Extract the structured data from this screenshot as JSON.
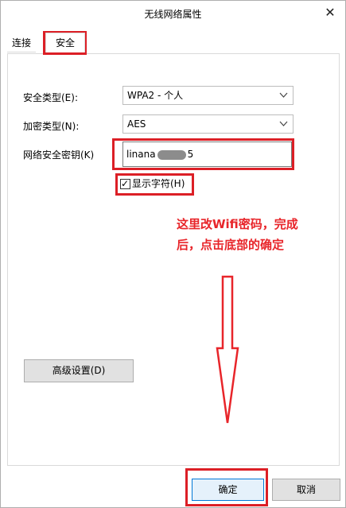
{
  "window": {
    "title": "无线网络属性",
    "close_symbol": "✕"
  },
  "tabs": [
    {
      "label": "连接",
      "selected": false
    },
    {
      "label": "安全",
      "selected": true
    }
  ],
  "form": {
    "security_type_label": "安全类型(E):",
    "security_type_value": "WPA2 - 个人",
    "encryption_type_label": "加密类型(N):",
    "encryption_type_value": "AES",
    "network_key_label": "网络安全密钥(K)",
    "network_key_prefix": "linana",
    "network_key_suffix": "5",
    "show_characters_label": "显示字符(H)",
    "show_characters_checked": true
  },
  "annotation": {
    "line1": "这里改Wifi密码，完成",
    "line2": "后，点击底部的确定"
  },
  "buttons": {
    "advanced": "高级设置(D)",
    "ok": "确定",
    "cancel": "取消"
  },
  "colors": {
    "annotation": "#e8252a",
    "highlight": "#dc1f26",
    "button_face": "#e1e1e1",
    "default_button_border": "#0078d7"
  },
  "icons": {
    "dropdown": "chevron-down-icon",
    "close": "close-icon",
    "checkbox": "checkmark-icon",
    "arrow": "down-arrow-icon"
  }
}
